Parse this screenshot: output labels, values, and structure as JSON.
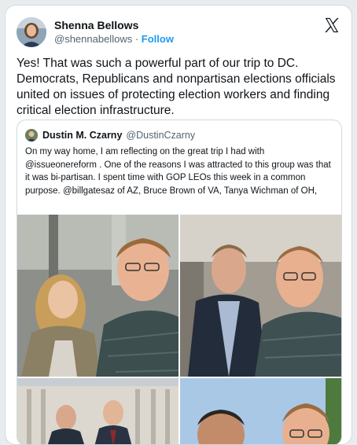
{
  "tweet": {
    "author_name": "Shenna Bellows",
    "author_handle": "@shennabellows",
    "separator": "·",
    "follow_label": "Follow",
    "text": "Yes!  That was such a powerful part of our trip to DC. Democrats, Republicans and nonpartisan elections officials united on issues of protecting election workers and finding critical election infrastructure."
  },
  "quoted": {
    "author_name": "Dustin M. Czarny",
    "author_handle": "@DustinCzarny",
    "text": "On my way home, I am reflecting on the great trip I had with @issueonereform .  One of the reasons I was attracted to this group was that it was bi-partisan.  I spent time with GOP LEOs this week in a common purpose.  @billgatesaz of AZ, Bruce Brown of VA, Tanya Wichman of OH,"
  },
  "icons": {
    "logo": "x-logo-icon",
    "avatar": "avatar",
    "quoted_avatar": "avatar"
  },
  "colors": {
    "link": "#1d9bf0",
    "border": "#cfd9de",
    "muted": "#536471",
    "text": "#0f1419"
  }
}
